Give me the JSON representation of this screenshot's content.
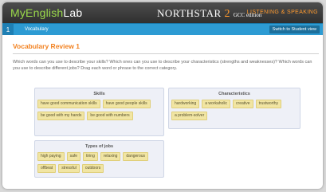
{
  "header": {
    "brand_part1": "MyEnglish",
    "brand_part2": "Lab",
    "northstar_name": "NORTHSTAR",
    "northstar_number": "2",
    "northstar_edition": "GCC edition",
    "skills": "LISTENING & SPEAKING"
  },
  "nav": {
    "number": "1",
    "title": "Vocabulary",
    "student_view_label": "Switch to Student view"
  },
  "activity": {
    "title": "Vocabulary Review 1",
    "instructions": "Which words can you use to describe your skills? Which ones can you use to describe your characteristics (strengths and weaknesses)? Which words can you use to describe different jobs? Drag each word or phrase to the correct category."
  },
  "skills_panel": {
    "title": "Skills",
    "items": [
      "have good communication skills",
      "have good people skills",
      "be good with my hands",
      "be good with numbers"
    ]
  },
  "characteristics_panel": {
    "title": "Characteristics",
    "items": [
      "hardworking",
      "a workaholic",
      "creative",
      "trustworthy",
      "a problem-solver"
    ]
  },
  "jobs_panel": {
    "title": "Types of jobs",
    "items": [
      "high paying",
      "safe",
      "tiring",
      "relaxing",
      "dangerous",
      "offbeat",
      "stressful",
      "outdoors"
    ]
  }
}
